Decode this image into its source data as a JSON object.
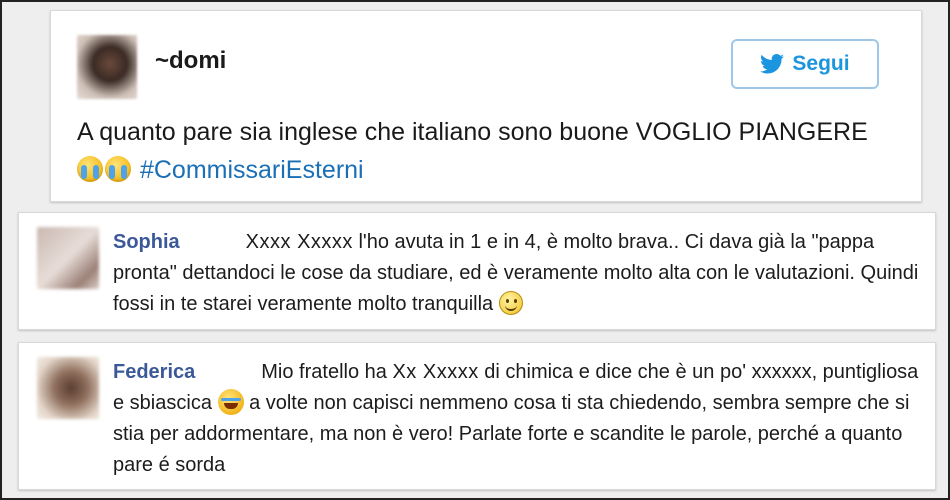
{
  "tweet": {
    "author": "~domi",
    "follow_label": "Segui",
    "text_before": "A quanto pare sia inglese che italiano sono buone VOGLIO PIANGERE",
    "hashtag": "#CommissariEsterni",
    "emojis": [
      "loudly-crying-face-icon",
      "loudly-crying-face-icon"
    ]
  },
  "comments": [
    {
      "name": "Sophia",
      "censored": "Xxxx Xxxxx",
      "text": "l'ho avuta in 1 e in 4, è molto brava.. Ci dava già la \"pappa pronta\" dettandoci le cose da studiare, ed è veramente molto alta con le valutazioni. Quindi fossi in te starei veramente molto tranquilla",
      "emoji": "smiling-face-icon"
    },
    {
      "name": "Federica",
      "text_a": "Mio fratello ha",
      "censored": "Xx Xxxxx",
      "text_b": "di chimica e dice che è un po' xxxxxx, puntigliosa e sbiascica",
      "text_c": "a volte non capisci nemmeno cosa ti sta chiedendo, sembra sempre che si stia per addormentare, ma non è vero! Parlate forte e scandite le parole, perché a quanto pare é sorda",
      "emoji": "tears-of-joy-face-icon"
    }
  ],
  "colors": {
    "twitter_blue": "#1b95e0",
    "hashtag": "#1b6fb5",
    "facebook_name": "#3b5998"
  }
}
